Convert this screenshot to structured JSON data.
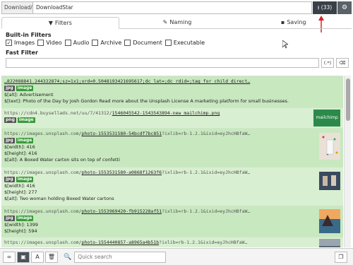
{
  "topbar": {
    "prefix": "Download/",
    "path_value": "DownloadStar",
    "download_label": "(33)",
    "download_icon": "download-icon",
    "settings_icon": "gear-icon"
  },
  "tabs": [
    {
      "label": "Filters",
      "icon": "filter-icon"
    },
    {
      "label": "Naming",
      "icon": "edit-icon"
    },
    {
      "label": "Saving",
      "icon": "save-icon"
    }
  ],
  "filters": {
    "builtin_title": "Built-in Filters",
    "options": [
      {
        "label": "Images",
        "checked": true
      },
      {
        "label": "Video",
        "checked": false
      },
      {
        "label": "Audio",
        "checked": false
      },
      {
        "label": "Archive",
        "checked": false
      },
      {
        "label": "Document",
        "checked": false
      },
      {
        "label": "Executable",
        "checked": false
      }
    ],
    "fast_title": "Fast Filter",
    "fast_value": "",
    "regex_label": "(.*)",
    "clear_icon": "eraser-icon"
  },
  "items": [
    {
      "url_pre": "…822088841.244322874;sz=1x1;ord=0.5048193421695617;dc_lat=;dc_rdid=;tag_for_child_direct…",
      "url_link": "",
      "url_post": "",
      "tags": [
        "jpg",
        "image"
      ],
      "props": [
        "$[alt]:  Advertisement",
        "$[text]:  Photo of the Day by Josh Gordon Read more about the Unsplash License A marketing platform for small businesses."
      ]
    },
    {
      "url_pre": "https://cdn4.buysellads.net/uu/7/41312/",
      "url_link": "1546045542-1543543894-new_mailchimp.png",
      "url_post": "",
      "tags": [
        "png",
        "image"
      ],
      "props": [],
      "thumb_text": "mailchimp"
    },
    {
      "url_pre": "https://images.unsplash.com/",
      "url_link": "photo-1553531580-54bcdf7bc851",
      "url_post": "?ixlib=rb-1.2.1&ixid=eyJhcHBfaW…",
      "tags": [
        "jpg",
        "image"
      ],
      "props": [
        "$[width]:  416",
        "$[height]:  416",
        "$[alt]:  A Boxed Water carton sits on top of confetti"
      ]
    },
    {
      "url_pre": "https://images.unsplash.com/",
      "url_link": "photo-1553531580-a0868f1263f6",
      "url_post": "?ixlib=rb-1.2.1&ixid=eyJhcHBfaW…",
      "tags": [
        "jpg",
        "image"
      ],
      "props": [
        "$[width]:  416",
        "$[height]:  277",
        "$[alt]:  Two woman holding Boxed Water cartons"
      ]
    },
    {
      "url_pre": "https://images.unsplash.com/",
      "url_link": "photo-1553969420-fb915228af51",
      "url_post": "?ixlib=rb-1.2.1&ixid=eyJhcHBfaW…",
      "tags": [
        "jpg",
        "image"
      ],
      "props": [
        "$[width]:  1399",
        "$[height]:  594"
      ]
    },
    {
      "url_pre": "https://images.unsplash.com/",
      "url_link": "photo-1554440857-a8965a4b51b",
      "url_post": "?ixlib=rb-1.2.1&ixid=eyJhcHBfaW…",
      "tags": [],
      "props": []
    }
  ],
  "bottombar": {
    "search_placeholder": "Quick search",
    "search_value": "",
    "buttons": [
      "link-icon",
      "image-icon",
      "text-icon",
      "trash-icon"
    ],
    "right_button": "copy-icon"
  }
}
